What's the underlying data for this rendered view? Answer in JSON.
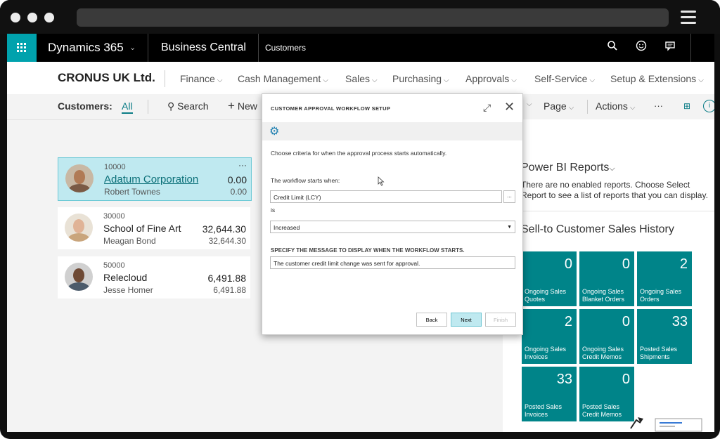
{
  "topbar": {
    "app_name": "Dynamics 365",
    "module": "Business Central",
    "page": "Customers"
  },
  "navbar": {
    "company": "CRONUS UK Ltd.",
    "menu": [
      "Finance",
      "Cash Management",
      "Sales",
      "Purchasing",
      "Approvals",
      "Self-Service",
      "Setup & Extensions"
    ]
  },
  "actionbar": {
    "label": "Customers:",
    "filter": "All",
    "search": "Search",
    "new": "New",
    "page": "Page",
    "actions": "Actions",
    "more": "···"
  },
  "customers": [
    {
      "number": "10000",
      "name": "Adatum Corporation",
      "contact": "Robert Townes",
      "balance": "0.00",
      "due": "0.00"
    },
    {
      "number": "30000",
      "name": "School of Fine Art",
      "contact": "Meagan Bond",
      "balance": "32,644.30",
      "due": "32,644.30"
    },
    {
      "number": "50000",
      "name": "Relecloud",
      "contact": "Jesse Homer",
      "balance": "6,491.88",
      "due": "6,491.88"
    }
  ],
  "card_menu": "···",
  "factbox": {
    "powerbi_title": "Power BI Reports",
    "powerbi_text": "There are no enabled reports. Choose Select Report to see a list of reports that you can display.",
    "history_title": "Sell-to Customer Sales History",
    "tiles": [
      {
        "value": "0",
        "label": "Ongoing Sales Quotes"
      },
      {
        "value": "0",
        "label": "Ongoing Sales Blanket Orders"
      },
      {
        "value": "2",
        "label": "Ongoing Sales Orders"
      },
      {
        "value": "2",
        "label": "Ongoing Sales Invoices"
      },
      {
        "value": "0",
        "label": "Ongoing Sales Credit Memos"
      },
      {
        "value": "33",
        "label": "Posted Sales Shipments"
      },
      {
        "value": "33",
        "label": "Posted Sales Invoices"
      },
      {
        "value": "0",
        "label": "Posted Sales Credit Memos"
      }
    ],
    "tile_color": "#008489"
  },
  "dialog": {
    "title": "CUSTOMER APPROVAL WORKFLOW SETUP",
    "intro": "Choose criteria for when the approval process starts automatically.",
    "starts_label": "The workflow starts when:",
    "field_value": "Credit Limit (LCY)",
    "lookup": "...",
    "is_label": "is",
    "condition_value": "Increased",
    "message_label": "SPECIFY THE MESSAGE TO DISPLAY WHEN THE WORKFLOW STARTS.",
    "message_value": "The customer credit limit change was sent for approval.",
    "back": "Back",
    "next": "Next",
    "finish": "Finish"
  },
  "colors": {
    "accent": "#00a2ad",
    "selected_card": "#bfe9f0",
    "next_button": "#bfe9f0"
  }
}
